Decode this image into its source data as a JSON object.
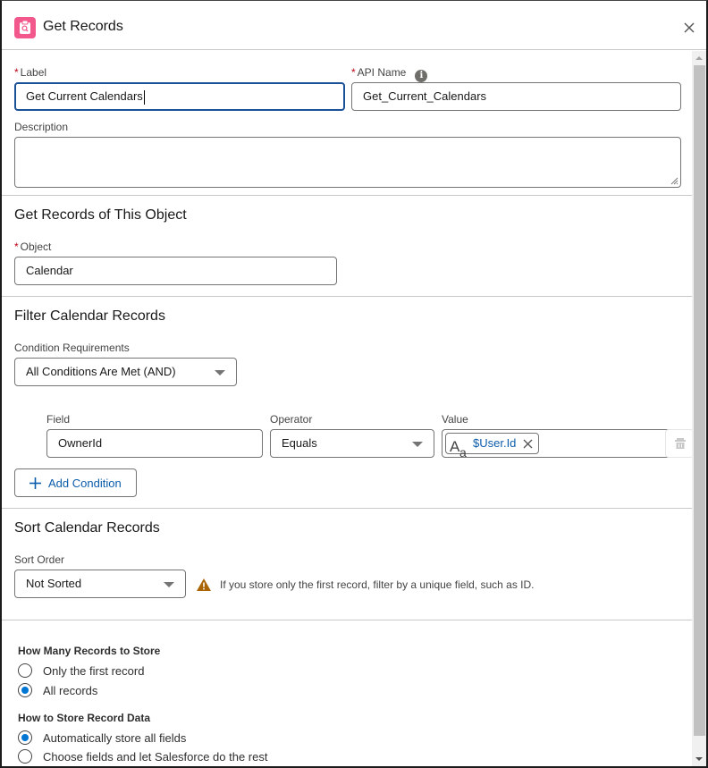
{
  "header": {
    "title": "Get Records",
    "icon": "get-records-icon",
    "icon_color": "#f2588b"
  },
  "general": {
    "label_field": {
      "label": "Label",
      "required": true,
      "value": "Get Current Calendars"
    },
    "api_name_field": {
      "label": "API Name",
      "required": true,
      "value": "Get_Current_Calendars",
      "info_icon": "i"
    },
    "description_field": {
      "label": "Description",
      "value": ""
    }
  },
  "object_section": {
    "title": "Get Records of This Object",
    "object_field": {
      "label": "Object",
      "required": true,
      "value": "Calendar"
    }
  },
  "filter_section": {
    "title": "Filter Calendar Records",
    "condition_requirements": {
      "label": "Condition Requirements",
      "value": "All Conditions Are Met (AND)"
    },
    "conditions": [
      {
        "field_label": "Field",
        "field_value": "OwnerId",
        "operator_label": "Operator",
        "operator_value": "Equals",
        "value_label": "Value",
        "value_pill": "$User.Id",
        "value_type_icon": "text-type-icon"
      }
    ],
    "add_condition_label": "Add Condition"
  },
  "sort_section": {
    "title": "Sort Calendar Records",
    "sort_order": {
      "label": "Sort Order",
      "value": "Not Sorted"
    },
    "warning": "If you store only the first record, filter by a unique field, such as ID."
  },
  "store_section": {
    "how_many": {
      "title": "How Many Records to Store",
      "options": [
        {
          "label": "Only the first record",
          "checked": false
        },
        {
          "label": "All records",
          "checked": true
        }
      ]
    },
    "how_to_store": {
      "title": "How to Store Record Data",
      "options": [
        {
          "label": "Automatically store all fields",
          "checked": true
        },
        {
          "label": "Choose fields and let Salesforce do the rest",
          "checked": false
        }
      ]
    }
  },
  "colors": {
    "accent": "#0176d3",
    "link": "#0b5cab",
    "required": "#ba0517",
    "warning": "#a96404",
    "focus": "#1b5297"
  }
}
